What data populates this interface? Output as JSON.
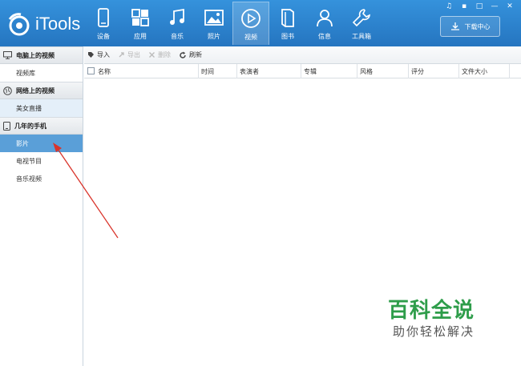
{
  "app": {
    "logo_text": "iTools"
  },
  "nav": {
    "items": [
      {
        "label": "设备",
        "icon": "phone-icon"
      },
      {
        "label": "应用",
        "icon": "apps-grid-icon"
      },
      {
        "label": "音乐",
        "icon": "music-note-icon"
      },
      {
        "label": "照片",
        "icon": "photo-icon"
      },
      {
        "label": "视频",
        "icon": "play-circle-icon",
        "active": true
      },
      {
        "label": "图书",
        "icon": "book-icon"
      },
      {
        "label": "信息",
        "icon": "contact-icon"
      },
      {
        "label": "工具箱",
        "icon": "wrench-icon"
      }
    ]
  },
  "download_center": {
    "label": "下载中心",
    "icon": "download-icon"
  },
  "window_controls": [
    "music-mini-icon",
    "chat-icon",
    "minimize-box-icon",
    "minimize-icon",
    "close-icon"
  ],
  "sidebar": {
    "groups": [
      {
        "title": "电脑上的视频",
        "icon": "monitor-icon",
        "items": [
          {
            "label": "视频库"
          }
        ]
      },
      {
        "title": "网络上的视频",
        "icon": "globe-icon",
        "items": [
          {
            "label": "美女直播",
            "state": "light"
          }
        ]
      },
      {
        "title": "几年的手机",
        "icon": "device-icon",
        "items": [
          {
            "label": "影片",
            "state": "selected"
          },
          {
            "label": "电视节目"
          },
          {
            "label": "音乐视频"
          }
        ]
      }
    ]
  },
  "toolbar": {
    "import_label": "导入",
    "export_label": "导出",
    "delete_label": "删除",
    "refresh_label": "刷新"
  },
  "table": {
    "columns": [
      "名称",
      "时间",
      "表演者",
      "专辑",
      "风格",
      "评分",
      "文件大小"
    ]
  },
  "watermark": {
    "title": "百科全说",
    "subtitle": "助你轻松解决"
  },
  "colors": {
    "header": "#2a7fc8",
    "selected": "#5a9fd8",
    "light_row": "#e4eff9",
    "annotation": "#d9342b",
    "watermark": "#2e9d4a"
  }
}
